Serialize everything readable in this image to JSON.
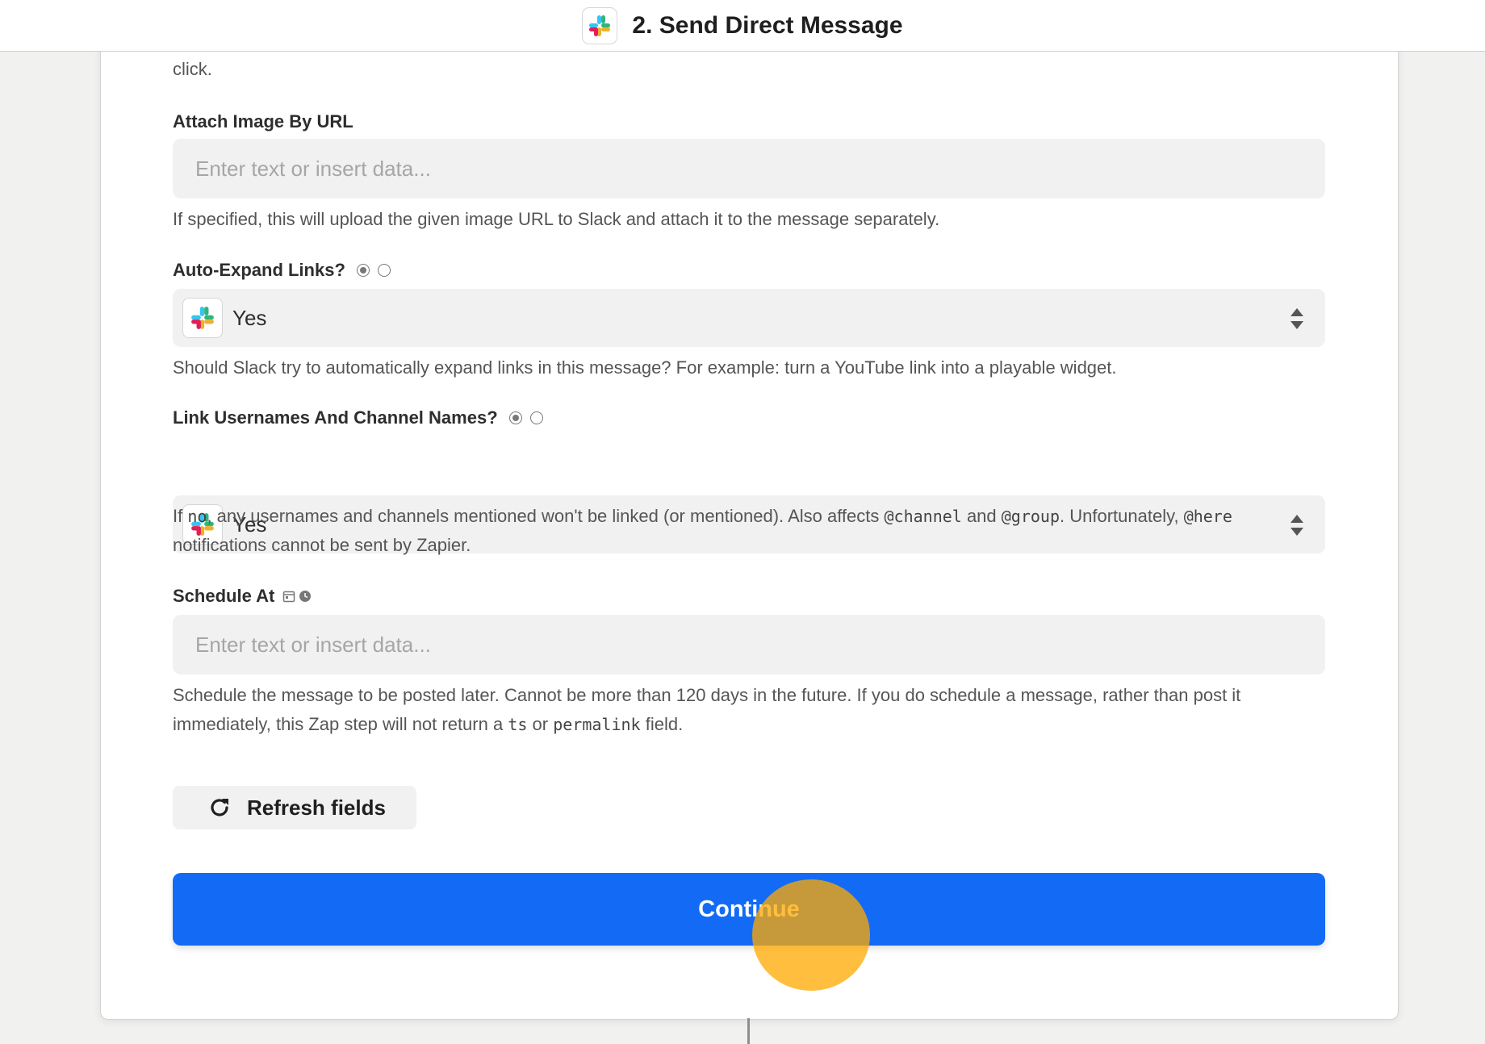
{
  "header": {
    "title": "2. Send Direct Message",
    "app_icon": "slack-icon"
  },
  "form": {
    "prev_help_tail": "click.",
    "attach_image": {
      "label": "Attach Image By URL",
      "placeholder": "Enter text or insert data...",
      "help": "If specified, this will upload the given image URL to Slack and attach it to the message separately."
    },
    "auto_expand": {
      "label": "Auto-Expand Links?",
      "value": "Yes",
      "help": "Should Slack try to automatically expand links in this message? For example: turn a YouTube link into a playable widget."
    },
    "link_names": {
      "label": "Link Usernames And Channel Names?",
      "value": "Yes",
      "help_parts": [
        "If ",
        "no",
        ", any usernames and channels mentioned won't be linked (or mentioned). Also affects ",
        "@channel",
        " and ",
        "@group",
        ". Unfortunately, ",
        "@here",
        " notifications cannot be sent by Zapier."
      ]
    },
    "schedule_at": {
      "label": "Schedule At",
      "placeholder": "Enter text or insert data...",
      "help_parts": [
        "Schedule the message to be posted later. Cannot be more than 120 days in the future. If you do schedule a message, rather than post it immediately, this Zap step will not return a ",
        "ts",
        " or ",
        "permalink",
        " field."
      ]
    }
  },
  "buttons": {
    "refresh": "Refresh fields",
    "continue": "Continue"
  },
  "colors": {
    "primary": "#136bf5",
    "click_highlight": "#ffaa00"
  }
}
